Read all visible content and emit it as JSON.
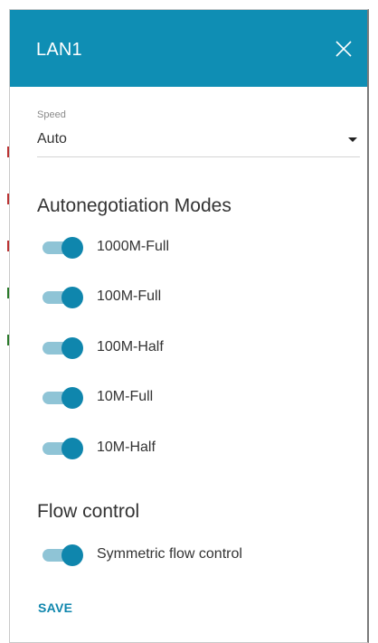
{
  "header": {
    "title": "LAN1",
    "close_icon": "close-icon"
  },
  "speed": {
    "label": "Speed",
    "value": "Auto"
  },
  "autoneg": {
    "title": "Autonegotiation Modes",
    "modes": [
      {
        "label": "1000M-Full",
        "enabled": true
      },
      {
        "label": "100M-Full",
        "enabled": true
      },
      {
        "label": "100M-Half",
        "enabled": true
      },
      {
        "label": "10M-Full",
        "enabled": true
      },
      {
        "label": "10M-Half",
        "enabled": true
      }
    ]
  },
  "flow": {
    "title": "Flow control",
    "toggles": [
      {
        "label": "Symmetric flow control",
        "enabled": true
      }
    ]
  },
  "save_label": "SAVE",
  "colors": {
    "header": "#0f8eb4",
    "accent": "#0f86ad",
    "track": "#8fc4d6"
  }
}
